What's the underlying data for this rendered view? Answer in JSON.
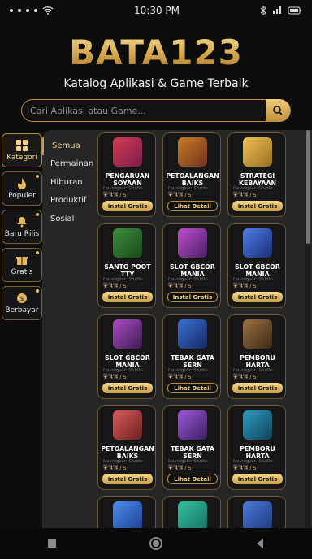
{
  "status": {
    "time": "10:30 PM",
    "icons": [
      "dots",
      "wifi",
      "bluetooth",
      "signal",
      "battery"
    ]
  },
  "header": {
    "title": "BATA123",
    "tagline": "Katalog Aplikasi & Game Terbaik"
  },
  "search": {
    "placeholder": "Cari Aplikasi atau Game..."
  },
  "left_nav": [
    {
      "label": "Kategori",
      "icon": "grid-icon",
      "active": true
    },
    {
      "label": "Populer",
      "icon": "flame-icon",
      "active": false
    },
    {
      "label": "Baru Rilis",
      "icon": "bell-icon",
      "active": false
    },
    {
      "label": "Gratis",
      "icon": "gift-icon",
      "active": false
    },
    {
      "label": "Berbayar",
      "icon": "dollar-icon",
      "active": false
    }
  ],
  "categories": [
    {
      "label": "Semua",
      "active": true
    },
    {
      "label": "Permainan",
      "active": false
    },
    {
      "label": "Hiburan",
      "active": false
    },
    {
      "label": "Produktif",
      "active": false
    },
    {
      "label": "Sosial",
      "active": false
    }
  ],
  "cards": [
    {
      "title": "PENGARUAN SOYAAN",
      "dev": "Devnigsor: Sfudio Mandiri",
      "rating": "★ 4.4 / 5",
      "button": "Instal Gratis",
      "style": "gold",
      "color": "#b4233b"
    },
    {
      "title": "PETOALANGAN BAIKS",
      "dev": "Devnigsor: Sfudio Mandiri",
      "rating": "★ 4.4 / 5",
      "button": "Lihat Detail",
      "style": "dark",
      "color": "#a8421f"
    },
    {
      "title": "STRATEGI KEBAYAAN",
      "dev": "Devnigsor: Sfudio Mandiri",
      "rating": "★ 4.4 / 5",
      "button": "Instal Gratis",
      "style": "gold",
      "color": "#d6a43b"
    },
    {
      "title": "SANTO POOT TTY",
      "dev": "Devnigsor: Sfudio Mandiri",
      "rating": "★ 4.4 / 5",
      "button": "Instal Gratis",
      "style": "gold",
      "color": "#2a6f2a"
    },
    {
      "title": "SLOT GBCOR MANIA",
      "dev": "Devnigsor: Sfudio Mandiri",
      "rating": "★ 4.4 / 5",
      "button": "Instal Gratis",
      "style": "dark",
      "color": "#8d3a9d"
    },
    {
      "title": "SLOT GBCOR MANIA",
      "dev": "Devnigsor: Sfudio Mandiri",
      "rating": "★ 4.4 / 5",
      "button": "Instal Gratis",
      "style": "gold",
      "color": "#2d4aa5"
    },
    {
      "title": "SLOT GBCOR MANIA",
      "dev": "Devnigsor: Sfudio Mandiri",
      "rating": "★ 4.4 / 5",
      "button": "Instal Gratis",
      "style": "gold",
      "color": "#7c3b8f"
    },
    {
      "title": "TEBAK GATA SERN",
      "dev": "Devnigsor: Sfudio Mandiri",
      "rating": "★ 4.4 / 5",
      "button": "Lihat Detail",
      "style": "dark",
      "color": "#2b4f97"
    },
    {
      "title": "PEMBORU HARTA",
      "dev": "Devnigsor: Sfudio Mandiri",
      "rating": "★ 4.4 / 5",
      "button": "Instal Gratis",
      "style": "gold",
      "color": "#6a4b2a"
    },
    {
      "title": "PETOALANGAN BAIKS",
      "dev": "Devnigsor: Sfudio Mandiri",
      "rating": "★ 4.4 / 5",
      "button": "Instal Gratis",
      "style": "gold",
      "color": "#b43e3e"
    },
    {
      "title": "TEBAK GATA SERN",
      "dev": "Devnigsor: Sfudio Mandiri",
      "rating": "★ 4.4 / 5",
      "button": "Lihat Detail",
      "style": "dark",
      "color": "#6b3a8d"
    },
    {
      "title": "PEMBORU HARTA",
      "dev": "Devnigsor: Sfudio Mandiri",
      "rating": "★ 4.4 / 5",
      "button": "Instal Gratis",
      "style": "gold",
      "color": "#1e6b87"
    },
    {
      "title": "",
      "dev": "",
      "rating": "",
      "button": "",
      "style": "none",
      "color": "#2c5dbb"
    },
    {
      "title": "",
      "dev": "",
      "rating": "",
      "button": "",
      "style": "none",
      "color": "#1f9a7a"
    },
    {
      "title": "",
      "dev": "",
      "rating": "",
      "button": "",
      "style": "none",
      "color": "#2d5fb0"
    }
  ]
}
